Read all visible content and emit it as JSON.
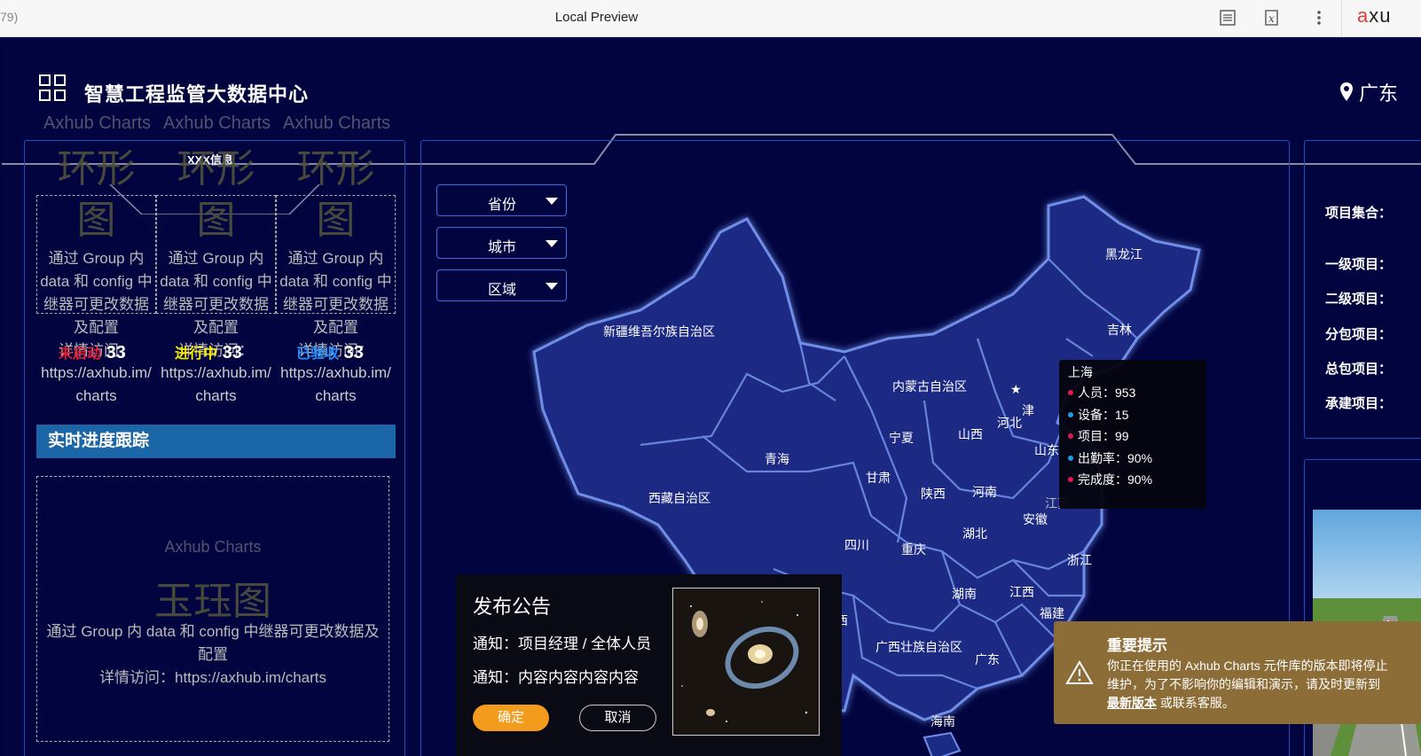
{
  "browser": {
    "left_text": "79)",
    "title": "Local Preview",
    "brand_prefix": "a",
    "brand_rest": "xu"
  },
  "header": {
    "title": "智慧工程监管大数据中心",
    "location": "广东"
  },
  "left_panel": {
    "tab_label": "XXX信息",
    "watermark": "Axhub Charts",
    "ring_chart_name": "环形图",
    "ring_chart_name_line1": "环形",
    "ring_chart_name_line2": "图",
    "ring_desc": [
      "通过 Group 内",
      "data 和 config 中",
      "继器可更改数据",
      "及配置",
      "详情访问："
    ],
    "ring_link": [
      "https://axhub.im/",
      "charts"
    ],
    "stats": [
      {
        "label": "未启动",
        "value": "33",
        "color": "#e0182c"
      },
      {
        "label": "进行中",
        "value": "33",
        "color": "#f5e900"
      },
      {
        "label": "已验收",
        "value": "33",
        "color": "#1e90ff"
      }
    ],
    "section_title": "实时进度跟踪",
    "progress_watermark": "Axhub Charts",
    "progress_chart_name": "玉珏图",
    "progress_desc_1": "通过 Group 内 data 和 config 中继器可更改数据及",
    "progress_desc_2": "配置",
    "progress_desc_3": "详情访问：https://axhub.im/charts"
  },
  "filters": {
    "province": "省份",
    "city": "城市",
    "district": "区域"
  },
  "map": {
    "labels": [
      {
        "name": "黑龙江"
      },
      {
        "name": "吉林"
      },
      {
        "name": "新疆维吾尔族自治区"
      },
      {
        "name": "内蒙古自治区"
      },
      {
        "name": "河北"
      },
      {
        "name": "津"
      },
      {
        "name": "山西"
      },
      {
        "name": "宁夏"
      },
      {
        "name": "山东"
      },
      {
        "name": "青海"
      },
      {
        "name": "甘肃"
      },
      {
        "name": "陕西"
      },
      {
        "name": "河南"
      },
      {
        "name": "江苏"
      },
      {
        "name": "西藏自治区"
      },
      {
        "name": "安徽"
      },
      {
        "name": "湖北"
      },
      {
        "name": "四川"
      },
      {
        "name": "重庆"
      },
      {
        "name": "浙江"
      },
      {
        "name": "湖南"
      },
      {
        "name": "江西"
      },
      {
        "name": "福建"
      },
      {
        "name": "西"
      },
      {
        "name": "广西壮族自治区"
      },
      {
        "name": "广东"
      },
      {
        "name": "海南"
      }
    ]
  },
  "tooltip": {
    "title": "上海",
    "rows": [
      {
        "text": "人员：953",
        "color": "#e0184a"
      },
      {
        "text": "设备：15",
        "color": "#1e9be0"
      },
      {
        "text": "项目：99",
        "color": "#e0184a"
      },
      {
        "text": "出勤率：90%",
        "color": "#1e9be0"
      },
      {
        "text": "完成度：90%",
        "color": "#e0184a"
      }
    ]
  },
  "notice": {
    "title": "发布公告",
    "line1": "通知：项目经理 / 全体人员",
    "line2": "通知：内容内容内容内容",
    "ok": "确定",
    "cancel": "取消"
  },
  "right_panel": {
    "labels": [
      "项目集合：",
      "一级项目：",
      "二级项目：",
      "分包项目：",
      "总包项目：",
      "承建项目："
    ]
  },
  "tip": {
    "title": "重要提示",
    "text_before": "你正在使用的 Axhub Charts 元件库的版本即将停止维护，为了不影响你的编辑和演示，请及时更新到",
    "link": "最新版本",
    "text_after": "或联系客服。"
  },
  "colors": {
    "background": "#01043f",
    "panel_border": "#1e4fb8",
    "section_bar": "#1b66a7",
    "ok_button": "#f29b1d",
    "tip_bg": "#8c6d37"
  }
}
